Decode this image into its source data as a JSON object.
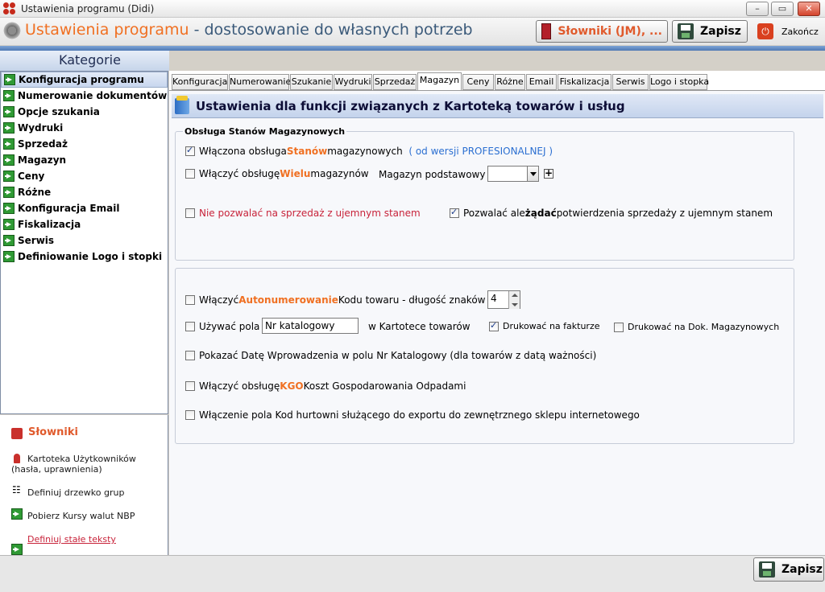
{
  "window": {
    "title": "Ustawienia programu (Didi)",
    "controls": {
      "minimize": "–",
      "maximize": "▭",
      "close": "✕"
    }
  },
  "header": {
    "title_part1": "Ustawienia programu",
    "title_part2": " - dostosowanie do własnych potrzeb",
    "slowniki_button": "Słowniki (JM), ...",
    "save_button": "Zapisz",
    "exit_button": "Zakończ"
  },
  "sidebar": {
    "title": "Kategorie",
    "items": [
      "Konfiguracja programu",
      "Numerowanie dokumentów",
      "Opcje szukania",
      "Wydruki",
      "Sprzedaż",
      "Magazyn",
      "Ceny",
      "Różne",
      "Konfiguracja Email",
      "Fiskalizacja",
      "Serwis",
      "Definiowanie Logo i stopki"
    ],
    "selected": "Konfiguracja programu"
  },
  "slowniki": {
    "title": "Słowniki",
    "items": [
      "Kartoteka Użytkowników",
      "(hasła, uprawnienia)",
      "Definiuj drzewko grup",
      "Pobierz Kursy walut NBP",
      "Definiuj stałe teksty"
    ]
  },
  "tabs": [
    "Konfiguracja",
    "Numerowanie",
    "Szukanie",
    "Wydruki",
    "Sprzedaż",
    "Magazyn",
    "Ceny",
    "Różne",
    "Email",
    "Fiskalizacja",
    "Serwis",
    "Logo i stopka"
  ],
  "active_tab": "Magazyn",
  "section": {
    "title": "Ustawienia dla funkcji związanych z Kartoteką towarów i usług"
  },
  "group1": {
    "label": "Obsługa Stanów Magazynowych",
    "opt1": {
      "a": "Włączona obsługa ",
      "b": "Stanów",
      "c": " magazynowych",
      "d": "( od wersji PROFESIONALNEJ )",
      "checked": true
    },
    "opt2": {
      "a": "Włączyć obsługę ",
      "b": "Wielu",
      "c": " magazynów",
      "checked": false
    },
    "warehouse_label": "Magazyn podstawowy",
    "warehouse_value": "",
    "opt3": {
      "text": "Nie pozwalać na sprzedaż z ujemnym stanem",
      "checked": false
    },
    "opt4": {
      "a": "Pozwalać ale ",
      "b": "żądać",
      "c": " potwierdzenia sprzedaży z ujemnym stanem",
      "checked": true
    }
  },
  "group2": {
    "opt1": {
      "a": "Włączyć ",
      "b": "Autonumerowanie",
      "c": " Kodu towaru  -  długość znaków",
      "checked": false
    },
    "length_value": "4",
    "opt2": {
      "a": "Używać pola",
      "checked": false
    },
    "field_value": "Nr katalogowy",
    "field_suffix": "w Kartotece towarów",
    "print_invoice": {
      "text": "Drukować na fakturze",
      "checked": true
    },
    "print_dok": {
      "text": "Drukować na Dok. Magazynowych",
      "checked": false
    },
    "opt3": {
      "text": "Pokazać Datę Wprowadzenia w polu Nr Katalogowy  (dla towarów z datą ważności)",
      "checked": false
    },
    "opt4": {
      "a": "Włączyć obsługę ",
      "b": "KGO",
      "c": " Koszt Gospodarowania Odpadami",
      "checked": false
    },
    "opt5": {
      "text": "Włączenie pola Kod hurtowni służącego do exportu do zewnętrznego sklepu internetowego",
      "checked": false
    }
  },
  "footer": {
    "save_button": "Zapisz"
  }
}
